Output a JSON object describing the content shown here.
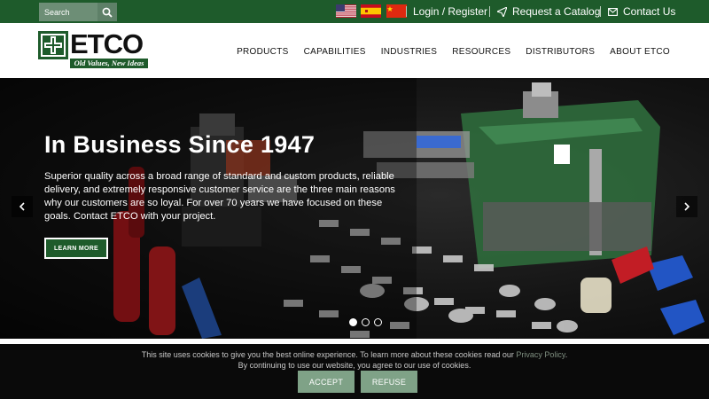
{
  "topbar": {
    "search_placeholder": "Search",
    "icons": {
      "search": "magnifier-icon",
      "login": "user-icon",
      "catalog": "paper-plane-icon",
      "contact": "envelope-icon"
    },
    "flags": [
      "flag-usa",
      "flag-spain",
      "flag-china"
    ],
    "login_label": "Login / Register",
    "catalog_label": "Request a Catalog",
    "contact_label": "Contact Us"
  },
  "header": {
    "logo_text": "ETCO",
    "logo_tagline": "Old Values, New Ideas",
    "nav": [
      "PRODUCTS",
      "CAPABILITIES",
      "INDUSTRIES",
      "RESOURCES",
      "DISTRIBUTORS",
      "ABOUT ETCO"
    ]
  },
  "hero": {
    "title": "In Business Since 1947",
    "body": "Superior quality across a broad range of standard and custom products, reliable delivery, and extremely responsive customer service are the three main reasons why our customers are so loyal. For over 70 years we have focused on these goals. Contact ETCO with your project.",
    "cta_label": "LEARN MORE",
    "prev_icon": "chevron-left-icon",
    "next_icon": "chevron-right-icon",
    "slides_total": 3,
    "active_slide": 1
  },
  "cookie": {
    "line1_prefix": "This site uses cookies to give you the best online experience. To learn more about these cookies read our ",
    "policy_link": "Privacy Policy",
    "line1_suffix": ".",
    "line2": "By continuing to use our website, you agree to our use of cookies.",
    "accept_label": "ACCEPT",
    "refuse_label": "REFUSE"
  },
  "colors": {
    "brand_green": "#1e5b2b",
    "cookie_button": "#7fa287",
    "cookie_bg": "#0a0a0a"
  }
}
